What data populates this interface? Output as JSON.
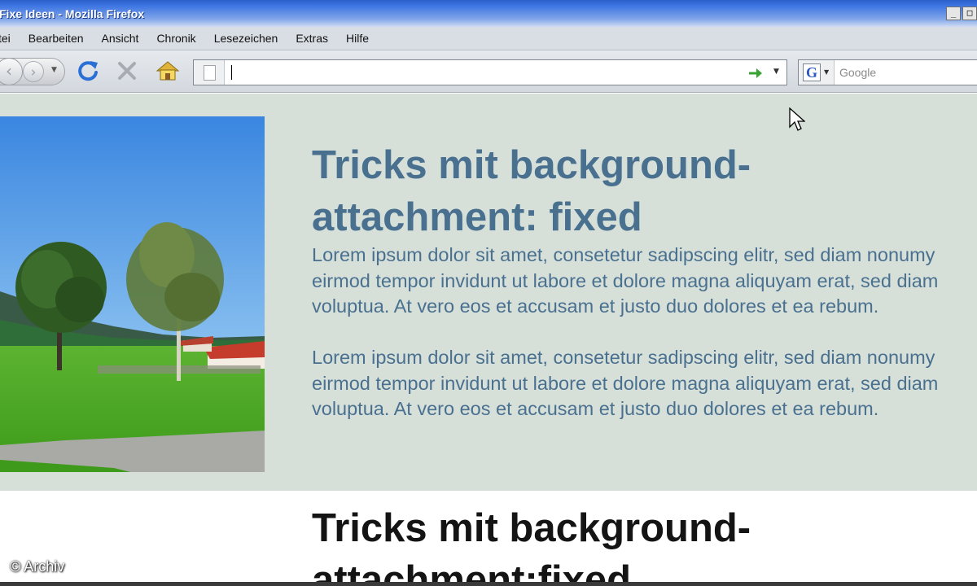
{
  "window": {
    "title": "Fixe Ideen - Mozilla Firefox",
    "controls": [
      "_",
      "□"
    ]
  },
  "menu": {
    "items": [
      "tei",
      "Bearbeiten",
      "Ansicht",
      "Chronik",
      "Lesezeichen",
      "Extras",
      "Hilfe"
    ]
  },
  "toolbar": {
    "url_value": "",
    "search_engine": "G",
    "search_placeholder": "Google"
  },
  "page": {
    "heading": "Tricks mit background-attachment: fixed",
    "paragraphs": [
      "Lorem ipsum dolor sit amet, consetetur sadipscing elitr, sed diam nonumy eirmod tempor invidunt ut labore et dolore magna aliquyam erat, sed diam voluptua. At vero eos et accusam et justo duo dolores et ea rebum.",
      "Lorem ipsum dolor sit amet, consetetur sadipscing elitr, sed diam nonumy eirmod tempor invidunt ut labore et dolore magna aliquyam erat, sed diam voluptua. At vero eos et accusam et justo duo dolores et ea rebum."
    ],
    "heading2": "Tricks mit background-attachment:fixed"
  },
  "watermark": "© Archiv",
  "colors": {
    "content_background": "#d6e0d9",
    "heading": "#4a7090",
    "heading2": "#141414"
  },
  "icons": [
    "back-icon",
    "forward-icon",
    "reload-icon",
    "stop-icon",
    "home-icon",
    "page-icon",
    "go-arrow-icon",
    "google-icon",
    "mouse-cursor-icon"
  ]
}
